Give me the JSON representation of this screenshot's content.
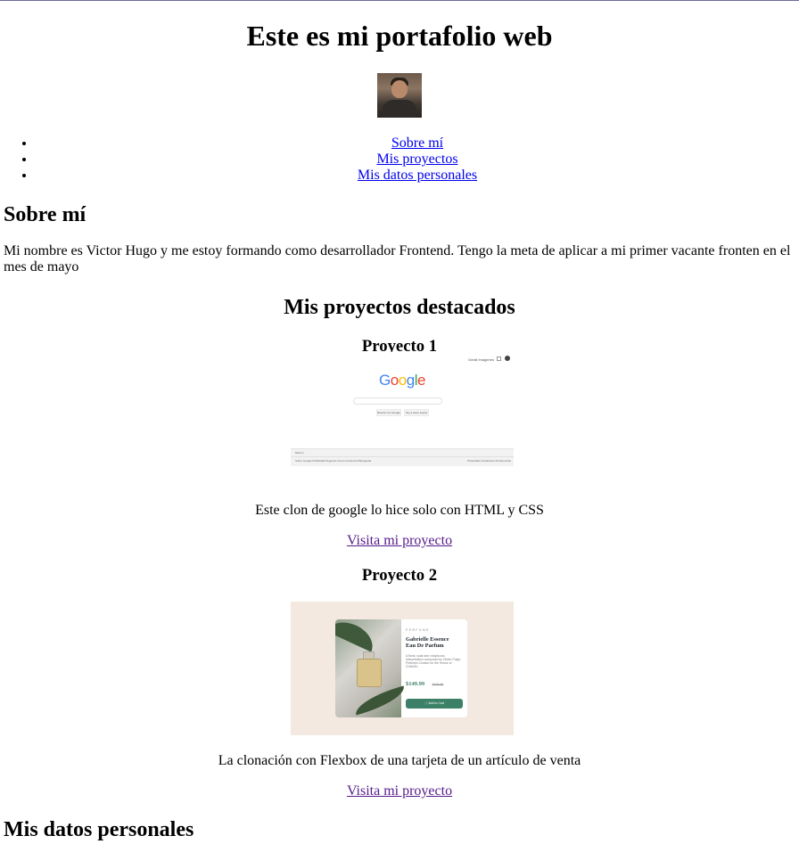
{
  "header": {
    "title": "Este es mi portafolio web",
    "nav": [
      {
        "label": "Sobre mí"
      },
      {
        "label": "Mis proyectos"
      },
      {
        "label": "Mis datos personales"
      }
    ]
  },
  "about": {
    "heading": "Sobre mí",
    "text": "Mi nombre es Victor Hugo y me estoy formando como desarrollador Frontend. Tengo la meta de aplicar a mi primer vacante fronten en el mes de mayo"
  },
  "projects": {
    "heading": "Mis proyectos destacados",
    "items": [
      {
        "title": "Proyecto 1",
        "description": "Este clon de google lo hice solo con HTML y CSS",
        "link": "Visita mi proyecto",
        "thumb": {
          "logo": [
            "G",
            "o",
            "o",
            "g",
            "l",
            "e"
          ],
          "logo_colors": [
            "#4285f4",
            "#ea4335",
            "#fbbc05",
            "#4285f4",
            "#34a853",
            "#ea4335"
          ],
          "top_links": "Gmail  Imágenes",
          "btn1": "Buscar con Google",
          "btn2": "Voy a tener suerte",
          "footer_country": "México",
          "footer_left": "Sobre Google   Publicidad   Negocios   Cómo funciona la Búsqueda",
          "footer_right": "Privacidad   Condiciones   Preferencias"
        }
      },
      {
        "title": "Proyecto 2",
        "description": "La clonación con Flexbox de una tarjeta de un artículo de venta",
        "link": "Visita mi proyecto",
        "thumb": {
          "category": "PERFUME",
          "name": "Gabrielle Essence Eau De Parfum",
          "desc": "A floral, solar and voluptuous interpretation composed by Olivier Polge, Perfumer-Creator for the House of CHANEL.",
          "price": "$149.99",
          "old_price": "$169.99",
          "button": "Add to Cart"
        }
      }
    ]
  },
  "contact": {
    "heading": "Mis datos personales"
  }
}
